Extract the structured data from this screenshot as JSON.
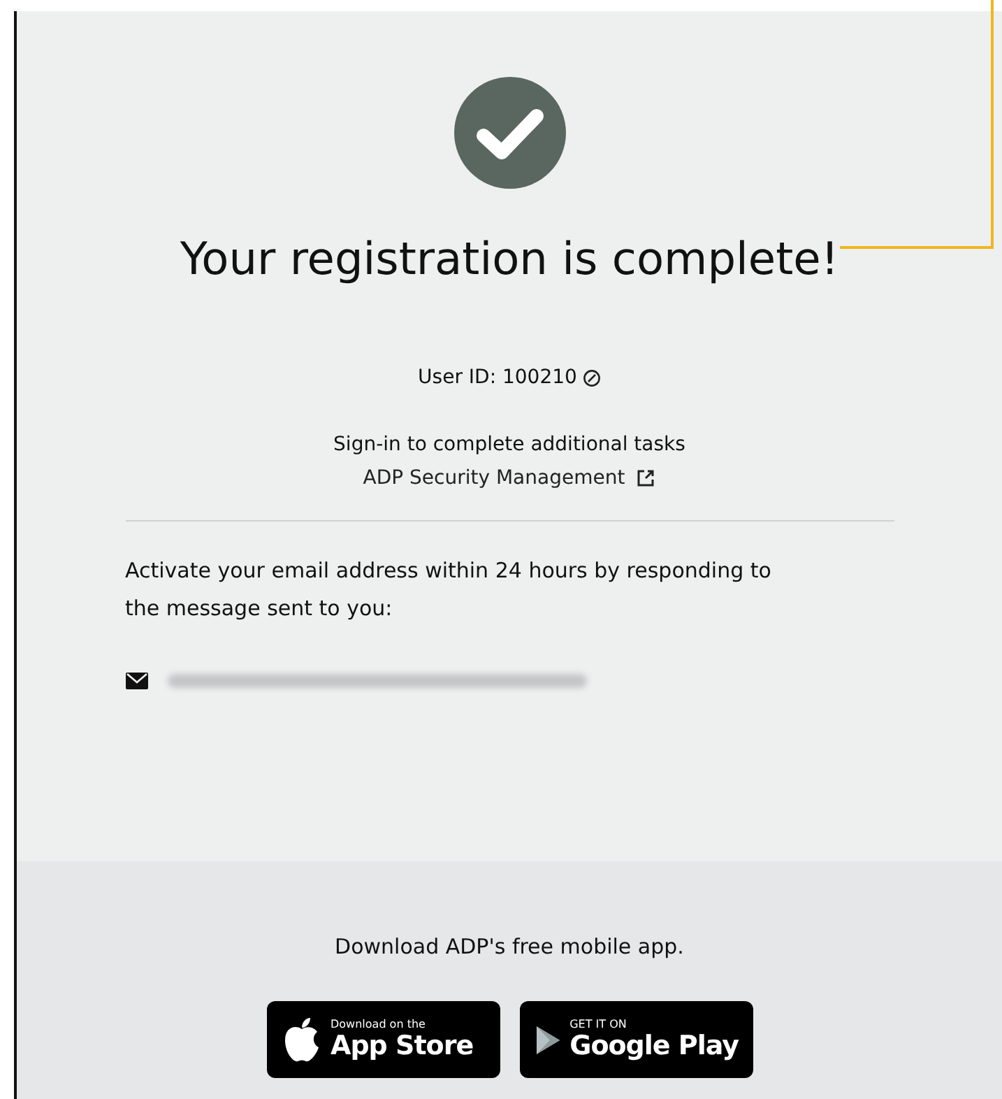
{
  "title": "Your registration is complete!",
  "user_id": {
    "label": "User ID: 100210"
  },
  "sign_in": {
    "text": "Sign-in to complete additional tasks",
    "link": "ADP Security Management"
  },
  "activation": {
    "text": "Activate your email address within 24 hours by responding to the message sent to you:",
    "email_redacted": true
  },
  "footer": {
    "text": "Download ADP's free mobile app.",
    "badges": [
      {
        "kind": "apple",
        "small": "Download on the",
        "big": "App Store"
      },
      {
        "kind": "google",
        "small": "GET IT ON",
        "big": "Google Play"
      }
    ]
  }
}
